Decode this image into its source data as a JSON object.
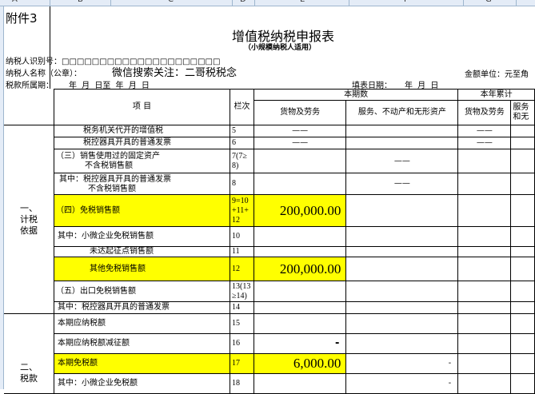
{
  "sheet": {
    "columns": [
      "A",
      "B",
      "C",
      "D",
      "E",
      "F",
      "G"
    ]
  },
  "header": {
    "attachment": "附件3",
    "title": "增值税纳税申报表",
    "subtitle": "（小规模纳税人适用）",
    "taxpayer_id_label": "纳税人识别号：□□□□□□□□□□□□□□□□□□□□□",
    "taxpayer_name_label": "纳税人名称（公章）：",
    "taxpayer_name_value": "微信搜索关注：二哥税税念",
    "amount_unit": "金额单位：元至角",
    "period_label": "税款所属期：",
    "period_value": "年 月 日至  年 月 日",
    "fill_date_label": "填表日期：",
    "fill_date_value": "年 月 日"
  },
  "table": {
    "item_header": "项 目",
    "line_header": "栏次",
    "current_period": "本期数",
    "year_cumulative": "本年累计",
    "goods": "货物及劳务",
    "services": "服务、不动产和无形资产",
    "goods2": "货物及劳务",
    "services2_a": "服务",
    "services2_b": "和无",
    "section1": "一、计税依据",
    "section2": "二、税款",
    "dash": "——",
    "rows": [
      {
        "item": "税务机关代开的增值税",
        "line": "5"
      },
      {
        "item": "税控器具开具的普通发票",
        "line": "6"
      },
      {
        "item": "（三）销售使用过的固定资产",
        "item2": "不含税销售额",
        "line": "7(7≥",
        "line2": "8)"
      },
      {
        "item": "其中：税控器具开具的普通发票",
        "item2": "不含税销售额",
        "line": "8"
      },
      {
        "item": "（四）免税销售额",
        "line": "9=10",
        "line2": "+11+",
        "line3": "12",
        "goods": "200,000.00"
      },
      {
        "item": "其中：小微企业免税销售额",
        "line": "10"
      },
      {
        "item": "未达起征点销售额",
        "line": "11"
      },
      {
        "item": "其他免税销售额",
        "line": "12",
        "goods": "200,000.00"
      },
      {
        "item": "（五）出口免税销售额",
        "line": "13(13",
        "line2": "≥14)"
      },
      {
        "item": "其中：税控器具开具的普通发票",
        "line": "14"
      },
      {
        "item": "本期应纳税额",
        "line": "15"
      },
      {
        "item": "本期应纳税额减征额",
        "line": "16",
        "goods": "-"
      },
      {
        "item": "本期免税额",
        "line": "17",
        "goods": "6,000.00",
        "services": "-"
      },
      {
        "item": "其中：小微企业免税额",
        "line": "18",
        "services": "-"
      }
    ]
  },
  "colors": {
    "highlight": "#ffff00",
    "header_bg": "#e4ecf7"
  }
}
